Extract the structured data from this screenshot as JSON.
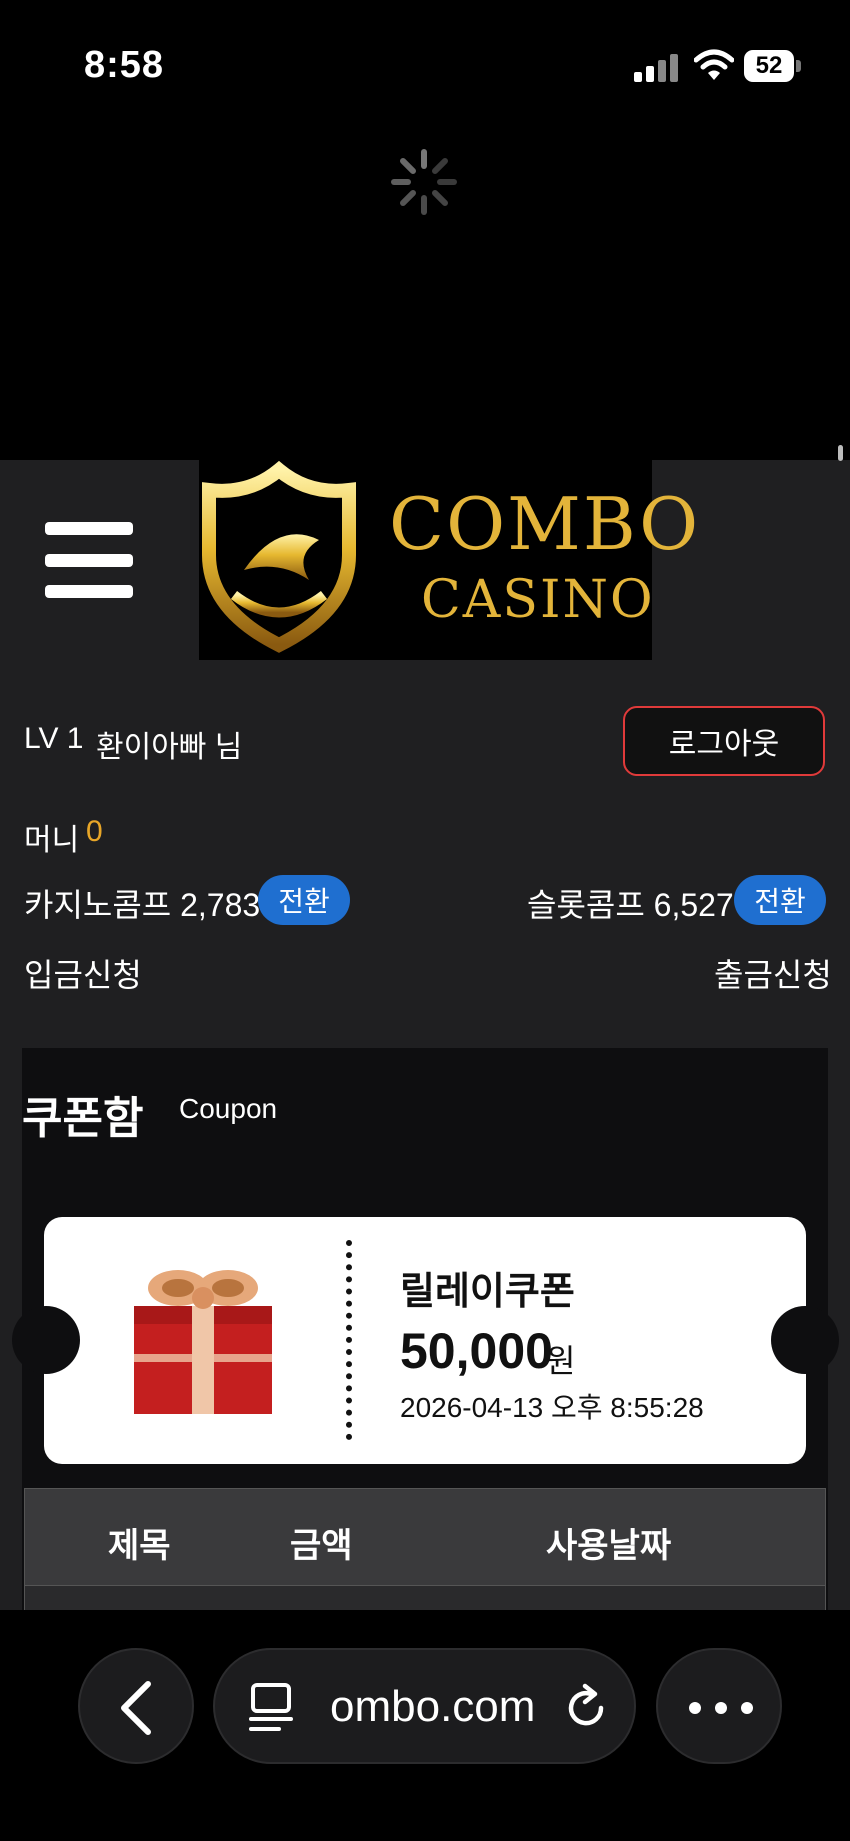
{
  "status_bar": {
    "time": "8:58",
    "battery": "52"
  },
  "header": {
    "logo_line1": "COMBO",
    "logo_line2": "CASINO"
  },
  "user": {
    "level": "LV 1",
    "name": "환이아빠 님",
    "logout_label": "로그아웃"
  },
  "balance": {
    "money_label": "머니",
    "money_value": "0"
  },
  "comps": {
    "casino_label": "카지노콤프 2,783",
    "slot_label": "슬롯콤프 6,527",
    "convert_label": "전환"
  },
  "links": {
    "deposit": "입금신청",
    "withdraw": "출금신청"
  },
  "coupon": {
    "title": "쿠폰함",
    "subtitle": "Coupon",
    "ticket": {
      "name": "릴레이쿠폰",
      "amount": "50,000",
      "unit": "원",
      "date": "2026-04-13 오후 8:55:28"
    },
    "table_headers": [
      "제목",
      "금액",
      "사용날짜"
    ]
  },
  "browser": {
    "url": "ombo.com"
  },
  "colors": {
    "accent_gold": "#e8a628",
    "logout_border": "#e03a3a",
    "convert_blue": "#1f6fd0"
  }
}
